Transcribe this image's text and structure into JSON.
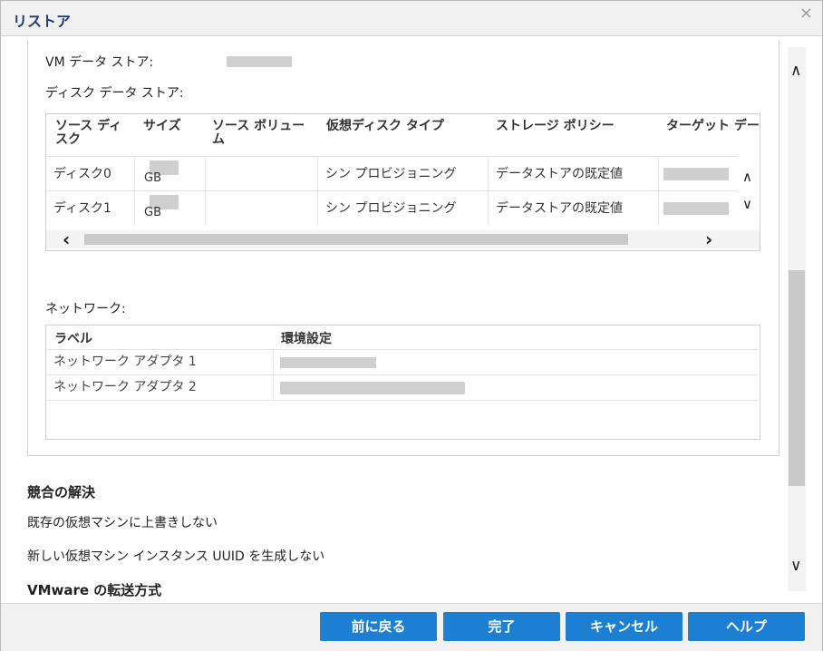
{
  "dialog": {
    "title": "リストア",
    "close_icon": "×"
  },
  "vm_datastore": {
    "label": "VM データ ストア:"
  },
  "disk_datastore": {
    "label": "ディスク データ ストア:",
    "headers": [
      {
        "line1": "ソース ディ",
        "line2": "スク"
      },
      {
        "line1": "サイズ",
        "line2": ""
      },
      {
        "line1": "ソース ボリュー",
        "line2": "ム"
      },
      {
        "line1": "仮想ディスク タイプ",
        "line2": ""
      },
      {
        "line1": "ストレージ ポリシー",
        "line2": ""
      },
      {
        "line1": "ターゲット デー",
        "line2": ""
      }
    ],
    "rows": [
      {
        "disk": "ディスク0",
        "size_unit": "GB",
        "volume": "",
        "type": "シン プロビジョニング",
        "policy": "データストアの既定値"
      },
      {
        "disk": "ディスク1",
        "size_unit": "GB",
        "volume": "",
        "type": "シン プロビジョニング",
        "policy": "データストアの既定値"
      }
    ],
    "scroll_left_icon": "‹",
    "scroll_right_icon": "›",
    "scroll_up_icon": "∧",
    "scroll_down_icon": "∨"
  },
  "network": {
    "label": "ネットワーク:",
    "headers": [
      "ラベル",
      "環境設定"
    ],
    "rows": [
      {
        "label": "ネットワーク アダプタ 1"
      },
      {
        "label": "ネットワーク アダプタ 2"
      }
    ]
  },
  "conflict": {
    "title": "競合の解決",
    "option1": "既存の仮想マシンに上書きしない",
    "option2": "新しい仮想マシン インスタンス UUID を生成しない"
  },
  "transfer": {
    "title": "VMware の転送方式"
  },
  "buttons": {
    "back": "前に戻る",
    "finish": "完了",
    "cancel": "キャンセル",
    "help": "ヘルプ"
  },
  "scroll_icons": {
    "up": "∧",
    "down": "∨"
  }
}
